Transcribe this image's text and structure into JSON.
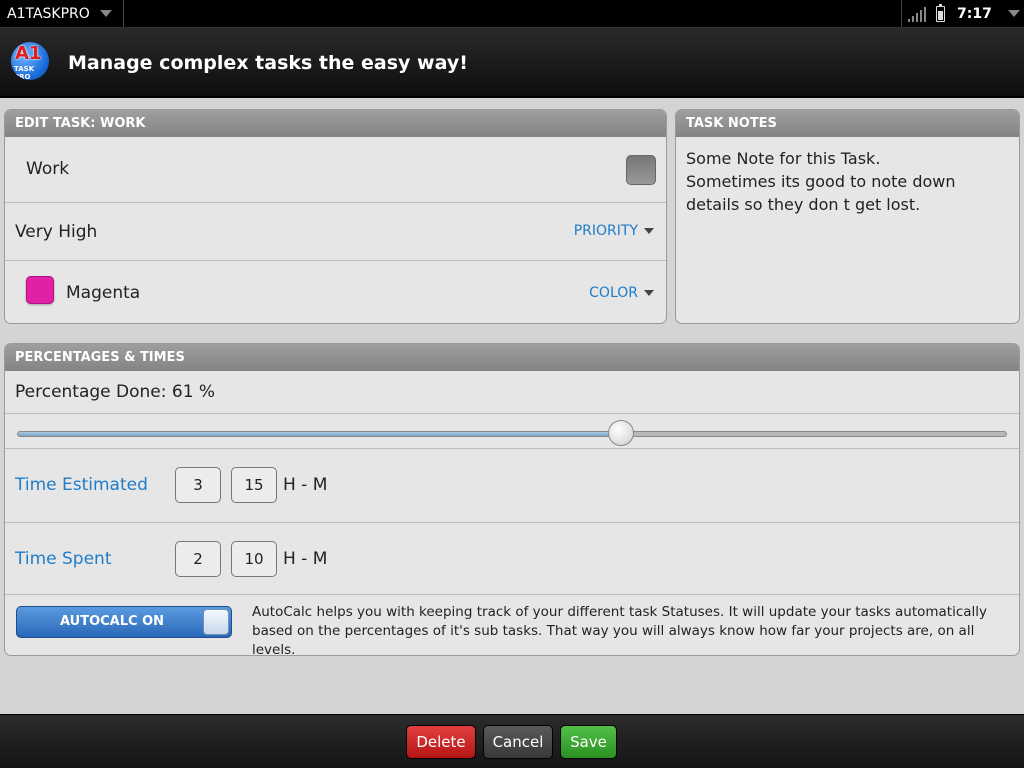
{
  "status_bar": {
    "app_name": "A1TASKPRO",
    "time": "7:17"
  },
  "header": {
    "logo_text": "A1",
    "logo_subtext": "TASK PRO",
    "title": "Manage complex tasks the easy way!"
  },
  "edit_task": {
    "title": "EDIT TASK: WORK",
    "name": "Work",
    "done": false,
    "priority_value": "Very High",
    "priority_label": "PRIORITY",
    "color_value": "Magenta",
    "color_label": "COLOR",
    "color_hex": "#e020a6"
  },
  "task_notes": {
    "title": "TASK NOTES",
    "lines": [
      "Some Note for this Task.",
      "Sometimes its good to note down",
      "details so they don t get lost."
    ]
  },
  "percentages": {
    "title": "PERCENTAGES & TIMES",
    "percentage_label": "Percentage Done: 61 %",
    "percent_done": 61,
    "time_estimated_label": "Time Estimated",
    "time_estimated_hours": "3",
    "time_estimated_minutes": "15",
    "time_spent_label": "Time Spent",
    "time_spent_hours": "2",
    "time_spent_minutes": "10",
    "unit_label": "H - M",
    "autocalc_label": "AUTOCALC ON",
    "autocalc_on": true,
    "autocalc_description": "AutoCalc helps you with keeping track of your different task Statuses. It will update your tasks automatically based on the percentages of it's sub tasks. That way you will always know how far your projects are, on all levels."
  },
  "actions": {
    "delete": "Delete",
    "cancel": "Cancel",
    "save": "Save"
  },
  "colors": {
    "accent_blue": "#1f7cc9",
    "delete": "#c62828",
    "save": "#3aa832"
  }
}
